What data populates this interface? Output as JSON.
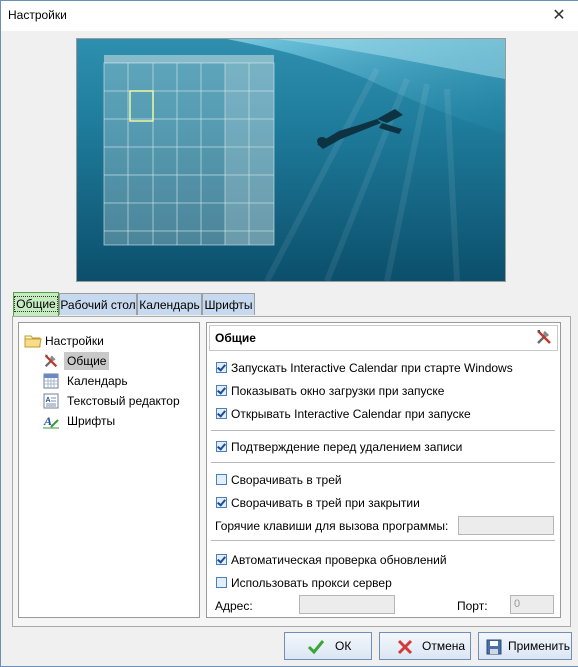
{
  "window": {
    "title": "Настройки"
  },
  "tabs": [
    "Общие",
    "Рабочий стол",
    "Календарь",
    "Шрифты"
  ],
  "tree": {
    "root": "Настройки",
    "items": [
      "Общие",
      "Календарь",
      "Текстовый редактор",
      "Шрифты"
    ]
  },
  "panel": {
    "header": "Общие",
    "options": [
      {
        "label": "Запускать Interactive Calendar при старте Windows",
        "checked": true
      },
      {
        "label": "Показывать окно загрузки при запуске",
        "checked": true
      },
      {
        "label": "Открывать Interactive Calendar при запуске",
        "checked": true
      },
      {
        "label": "Подтверждение перед удалением записи",
        "checked": true
      },
      {
        "label": "Сворачивать в трей",
        "checked": false
      },
      {
        "label": "Сворачивать в трей при закрытии",
        "checked": true
      },
      {
        "label": "Автоматическая проверка обновлений",
        "checked": true
      },
      {
        "label": "Использовать прокси сервер",
        "checked": false
      }
    ],
    "hotkey_label": "Горячие клавиши для вызова программы:",
    "hotkey_value": "",
    "address_label": "Адрес:",
    "address_value": "",
    "port_label": "Порт:",
    "port_value": "0"
  },
  "buttons": {
    "ok": "ОК",
    "cancel": "Отмена",
    "apply": "Применить"
  },
  "icons": {
    "close": "close-icon",
    "folder": "folder-icon",
    "tools": "tools-icon",
    "calendar": "calendar-icon",
    "text": "text-editor-icon",
    "font": "font-icon",
    "check": "check-icon",
    "cross": "cross-icon",
    "save": "save-icon"
  },
  "colors": {
    "active_tab": "#c5ecc0",
    "tab": "#c7d9ee",
    "button_border": "#6f8fb8"
  }
}
